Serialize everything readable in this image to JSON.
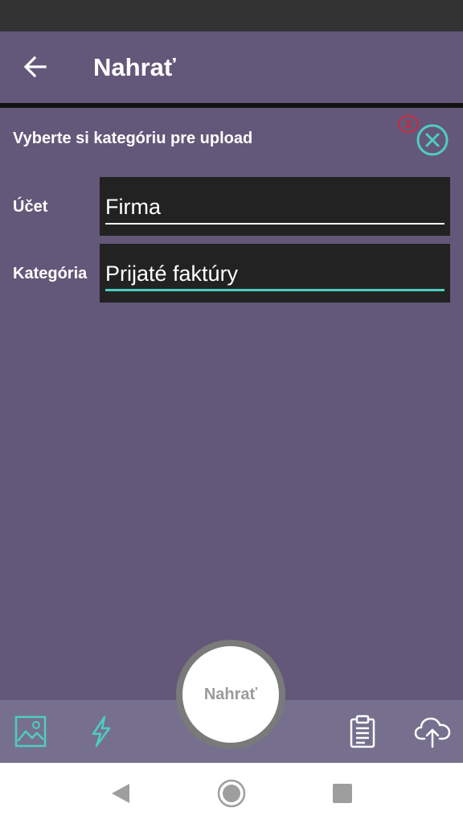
{
  "app_bar": {
    "title": "Nahrať",
    "back_icon": "arrow-left-icon"
  },
  "panel": {
    "title": "Vyberte si kategóriu pre upload",
    "badge_count": "2",
    "close_icon": "close-circle-icon"
  },
  "form": {
    "account": {
      "label": "Účet",
      "value": "Firma"
    },
    "category": {
      "label": "Kategória",
      "value": "Prijaté faktúry"
    }
  },
  "toolbar": {
    "upload_label": "Nahrať",
    "gallery_icon": "image-icon",
    "flash_icon": "flash-icon",
    "clipboard_icon": "clipboard-icon",
    "cloud_icon": "cloud-upload-icon"
  },
  "colors": {
    "background": "#635879",
    "accent": "#4ecdc0",
    "badge": "#d0273d",
    "field_bg": "#222222"
  }
}
